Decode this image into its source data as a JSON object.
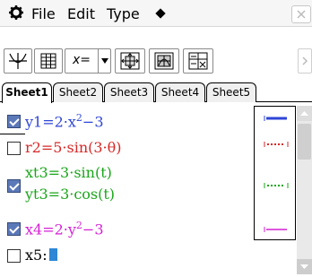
{
  "menubar": {
    "file": "File",
    "edit": "Edit",
    "type": "Type"
  },
  "toolbar": {
    "x_equals": "x="
  },
  "tabs": [
    "Sheet1",
    "Sheet2",
    "Sheet3",
    "Sheet4",
    "Sheet5"
  ],
  "equations": [
    {
      "lhs": "y1=",
      "rhs": "2·x",
      "exp": "2",
      "tail": "−3",
      "checked": true,
      "color": "#2f45d6"
    },
    {
      "lhs": "r2=",
      "rhs": "5·sin(3·θ)",
      "checked": false,
      "color": "#d62828"
    },
    {
      "lhs": "xt3=",
      "rhs": "3·sin(t)",
      "lhs2": "yt3=",
      "rhs2": "3·cos(t)",
      "checked": true,
      "color": "#1aa61a"
    },
    {
      "lhs": "x4=",
      "rhs": "2·y",
      "exp": "2",
      "tail": "−3",
      "checked": true,
      "color": "#d61fd6"
    },
    {
      "lhs": "x5:",
      "checked": false,
      "color": "#000000"
    }
  ],
  "colors": {
    "blue": "#2f45d6",
    "red": "#d62828",
    "green": "#1aa61a",
    "magenta": "#d61fd6"
  }
}
